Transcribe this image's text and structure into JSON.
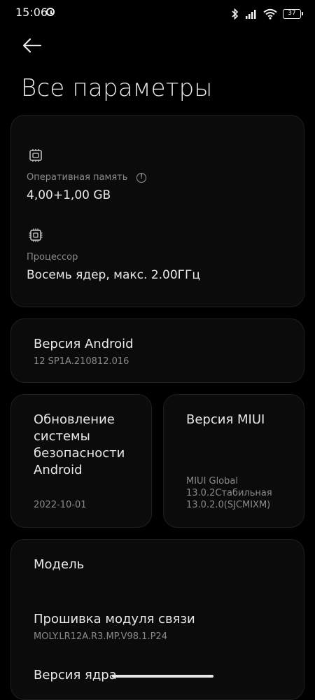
{
  "status_bar": {
    "time": "15:06",
    "battery": "37",
    "icons": [
      "alarm-icon",
      "bluetooth-icon",
      "signal-icon",
      "wifi-icon",
      "battery-icon"
    ]
  },
  "header": {
    "back_icon": "arrow-left-icon",
    "title": "Все параметры"
  },
  "specs": {
    "ram_icon": "chip-icon",
    "ram_label": "Оперативная память",
    "ram_info_icon": "info-icon",
    "ram_value": "4,00+1,00 GB",
    "cpu_icon": "processor-icon",
    "cpu_label": "Процессор",
    "cpu_value": "Восемь ядер, макс. 2.00ГГц"
  },
  "android": {
    "title": "Версия Android",
    "value": "12 SP1A.210812.016"
  },
  "security": {
    "title_lines": [
      "Обновление",
      "системы",
      "безопасности",
      "Android"
    ],
    "value": "2022-10-01"
  },
  "miui": {
    "title": "Версия MIUI",
    "value_lines": [
      "MIUI Global",
      "13.0.2Стабильная",
      "13.0.2.0(SJCMIXM)"
    ]
  },
  "model": {
    "model_label": "Модель",
    "baseband_label": "Прошивка модуля связи",
    "baseband_value": "MOLY.LR12A.R3.MP.V98.1.P24",
    "kernel_label": "Версия ядра"
  },
  "colors": {
    "background": "#000000",
    "card": "#0b0b0b",
    "text_primary": "#e8e8e8",
    "text_secondary": "#8a8a8a"
  }
}
